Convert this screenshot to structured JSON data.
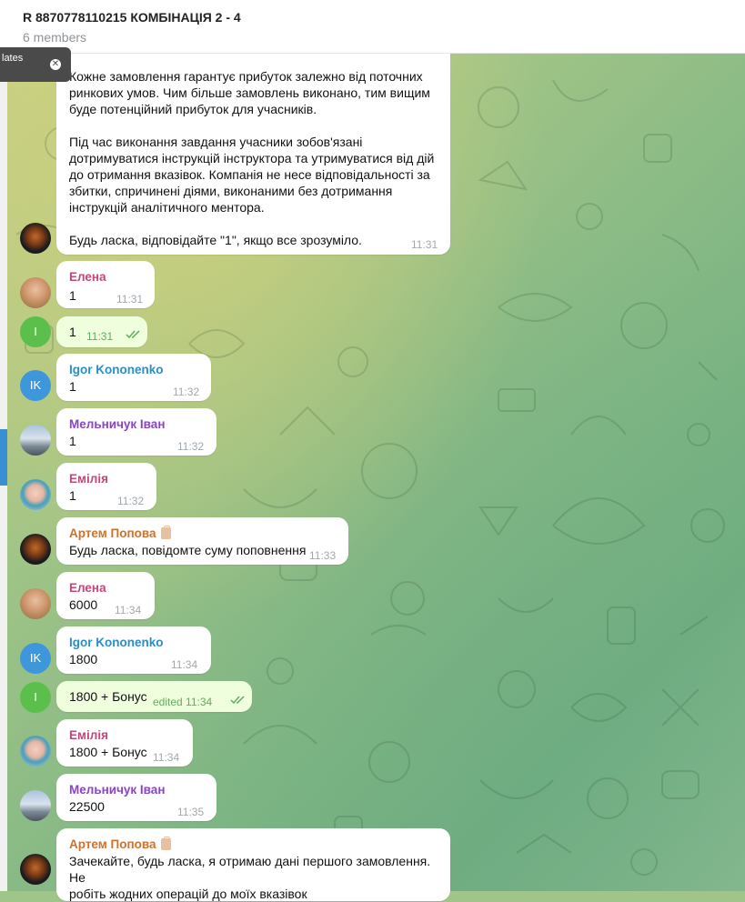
{
  "header": {
    "title": "R 8870778110215 КОМБІНАЦІЯ 2 - 4",
    "subtitle": "6 members"
  },
  "tooltip": {
    "text": "lates",
    "close_icon": "close-icon"
  },
  "colors": {
    "name_elena": "#c2477a",
    "name_igor": "#2a8ec9",
    "name_ivan": "#8a43c9",
    "name_emilia": "#c2477a",
    "name_artem": "#d2702a",
    "accent": "#3a8fd4"
  },
  "messages": [
    {
      "sender": "",
      "avatar": "dark",
      "lines": [
        "Кожне замовлення гарантує прибуток залежно від поточних",
        "ринкових умов. Чим більше замовлень виконано, тим вищим",
        "буде потенційний прибуток для учасників.",
        "",
        "Під час виконання завдання учасники зобов'язані",
        "дотримуватися інструкцій інструктора та утримуватися від дій",
        "до отримання вказівок. Компанія не несе відповідальності за",
        "збитки, спричинені діями, виконаними без дотримання",
        "інструкцій аналітичного ментора.",
        "",
        "Будь ласка, відповідайте \"1\", якщо все зрозуміло."
      ],
      "time": "11:31"
    },
    {
      "sender": "Елена",
      "avatar": "elena",
      "text": "1",
      "time": "11:31"
    },
    {
      "sender": "",
      "avatar": "I",
      "text": "1",
      "time": "11:31",
      "outgoing": true
    },
    {
      "sender": "Igor Kononenko",
      "avatar": "IK",
      "text": "1",
      "time": "11:32"
    },
    {
      "sender": "Мельничук Іван",
      "avatar": "ivan",
      "text": "1",
      "time": "11:32"
    },
    {
      "sender": "Емілія",
      "avatar": "emilia",
      "text": "1",
      "time": "11:32"
    },
    {
      "sender": "Артем Попова",
      "avatar": "dark",
      "text": "Будь ласка, повідомте суму поповнення",
      "time": "11:33"
    },
    {
      "sender": "Елена",
      "avatar": "elena",
      "text": "6000",
      "time": "11:34"
    },
    {
      "sender": "Igor Kononenko",
      "avatar": "IK",
      "text": "1800",
      "time": "11:34"
    },
    {
      "sender": "",
      "avatar": "I",
      "text": "1800 + Бонус",
      "time": "edited 11:34",
      "outgoing": true
    },
    {
      "sender": "Емілія",
      "avatar": "emilia",
      "text": "1800 + Бонус",
      "time": "11:34"
    },
    {
      "sender": "Мельничук Іван",
      "avatar": "ivan",
      "text": "22500",
      "time": "11:35"
    },
    {
      "sender": "Артем Попова",
      "avatar": "dark",
      "lines": [
        "Зачекайте, будь ласка, я отримаю дані першого замовлення. Не",
        "робіть жодних операцій до моїх вказівок"
      ],
      "time": ""
    }
  ],
  "avatar_initials": {
    "I": "I",
    "IK": "IK"
  }
}
